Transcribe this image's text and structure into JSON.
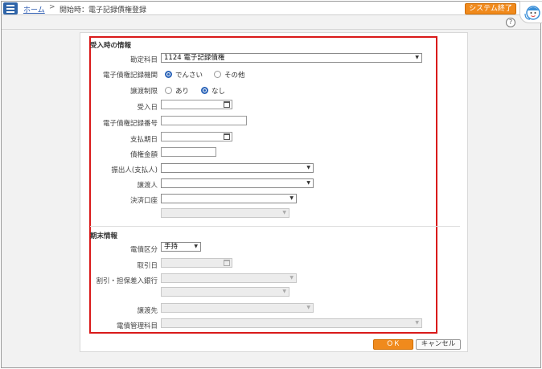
{
  "header": {
    "breadcrumb_home": "ホーム",
    "breadcrumb_sep": ">",
    "breadcrumb_current": "開始時：電子記録債権登録",
    "system_exit": "システム終了",
    "help": "?"
  },
  "section1": {
    "title": "受入時の情報",
    "account_label": "勘定科目",
    "account_value": "1124 電子記録債権",
    "agency_label": "電子債権記録機関",
    "agency_opt1": "でんさい",
    "agency_opt2": "その他",
    "transfer_label": "譲渡制限",
    "transfer_opt1": "あり",
    "transfer_opt2": "なし",
    "recv_date_label": "受入日",
    "record_no_label": "電子債権記録番号",
    "due_date_label": "支払期日",
    "amount_label": "債権金額",
    "drawer_label": "振出人(支払人)",
    "assignor_label": "譲渡人",
    "settle_label": "決済口座"
  },
  "section2": {
    "title": "期末情報",
    "category_label": "電債区分",
    "category_value": "手持",
    "trade_date_label": "取引日",
    "discount_bank_label": "割引・担保差入銀行",
    "transferee_label": "譲渡先",
    "mgmt_account_label": "電債管理科目"
  },
  "footer": {
    "ok": "ＯＫ",
    "cancel": "キャンセル"
  },
  "colors": {
    "accent": "#f08a1c",
    "menu": "#2f64a8",
    "highlight": "#d91a1a"
  }
}
